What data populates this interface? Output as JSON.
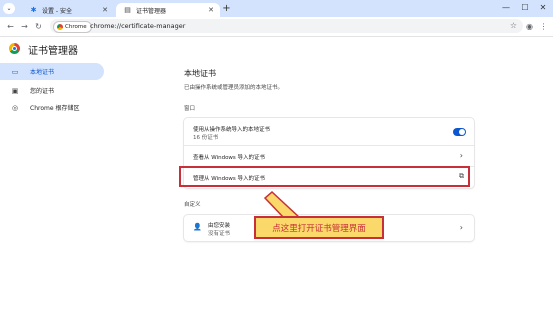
{
  "tabs": {
    "inactive": {
      "label": "设置 - 安全"
    },
    "active": {
      "label": "证书管理器"
    }
  },
  "toolbar": {
    "chip_label": "Chrome",
    "url": "chrome://certificate-manager"
  },
  "page": {
    "title": "证书管理器"
  },
  "sidebar": {
    "items": [
      {
        "label": "本地证书",
        "icon": "monitor-icon",
        "active": true
      },
      {
        "label": "您的证书",
        "icon": "id-card-icon",
        "active": false
      },
      {
        "label": "Chrome 根存储区",
        "icon": "chrome-icon",
        "active": false
      }
    ]
  },
  "main": {
    "heading": "本地证书",
    "description": "已由操作系统或管理员添加的本地证书。",
    "section_windows": {
      "label": "窗口",
      "rows": [
        {
          "label": "使用从操作系统导入的本地证书",
          "sub": "16 份证书"
        },
        {
          "label": "查看从 Windows 导入的证书"
        },
        {
          "label": "管理从 Windows 导入的证书"
        }
      ]
    },
    "section_custom": {
      "label": "自定义",
      "row": {
        "label": "由您安装",
        "sub": "没有证书"
      }
    }
  },
  "annotation": {
    "text": "点这里打开证书管理界面"
  },
  "colors": {
    "accent": "#0b57d0",
    "highlight": "#c7303a",
    "callout_bg": "#fbd86a"
  }
}
